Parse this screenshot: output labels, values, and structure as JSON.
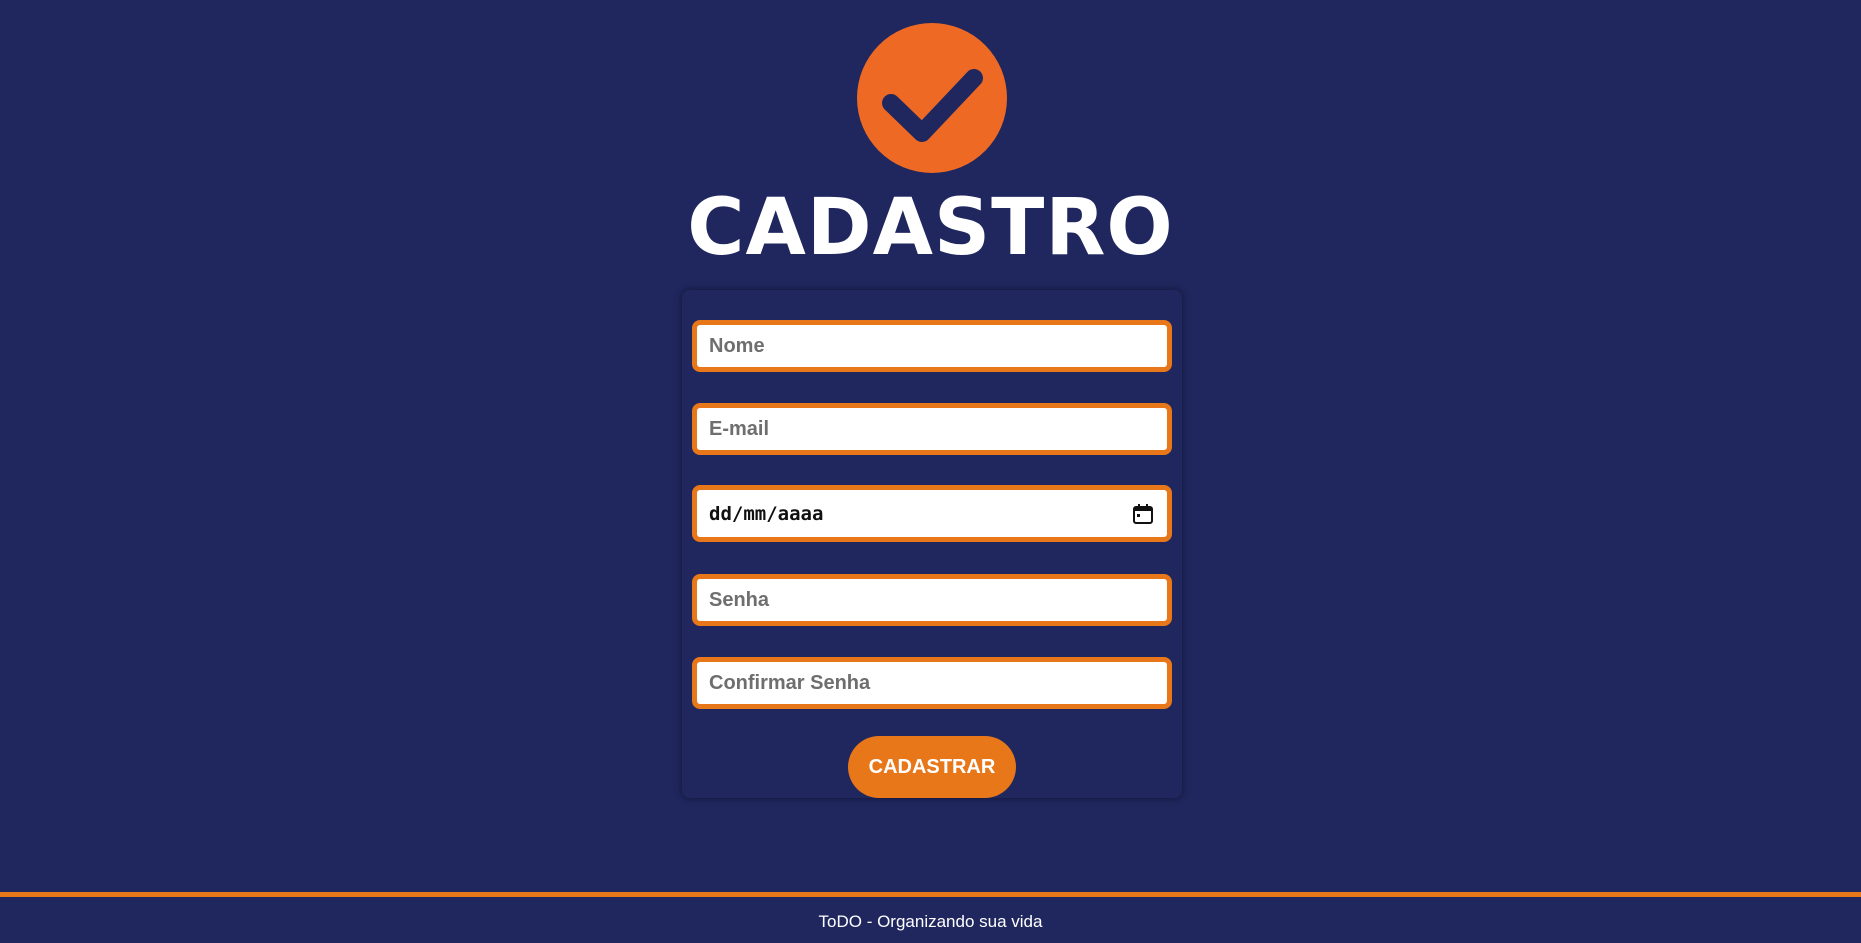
{
  "logo": {
    "icon": "checkmark-icon",
    "color": "#ee6a24"
  },
  "page": {
    "title": "CADASTRO"
  },
  "form": {
    "name_placeholder": "Nome",
    "email_placeholder": "E-mail",
    "date_placeholder": "dd/mm/aaaa",
    "date_icon": "calendar-icon",
    "password_placeholder": "Senha",
    "confirm_password_placeholder": "Confirmar Senha",
    "submit_label": "CADASTRAR"
  },
  "footer": {
    "text": "ToDO - Organizando sua vida"
  },
  "colors": {
    "background": "#1f275e",
    "accent": "#e8771a",
    "logo": "#ee6a24",
    "text_light": "#ffffff"
  }
}
